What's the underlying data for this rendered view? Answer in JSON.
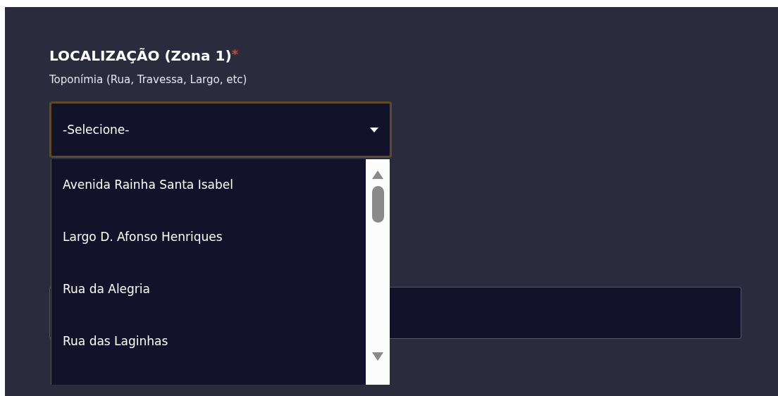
{
  "section": {
    "title": "LOCALIZAÇÃO (Zona 1)",
    "required_mark": "*",
    "subtitle": "Toponímia (Rua, Travessa, Largo, etc)"
  },
  "select": {
    "placeholder": "-Selecione-",
    "expanded": true,
    "options": [
      {
        "label": "Avenida Rainha Santa Isabel",
        "selected": false
      },
      {
        "label": "Largo D. Afonso Henriques",
        "selected": false
      },
      {
        "label": "Rua da Alegria",
        "selected": false
      },
      {
        "label": "Rua das Laginhas",
        "selected": false
      }
    ]
  },
  "fields_below": [
    {
      "kind": "text"
    }
  ]
}
